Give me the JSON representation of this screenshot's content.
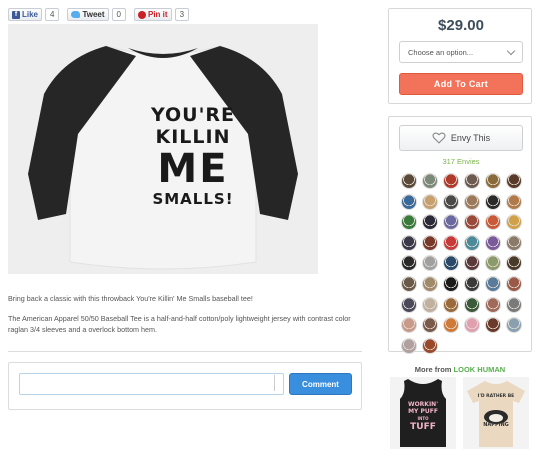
{
  "social": {
    "facebook": {
      "label": "Like",
      "count": "4"
    },
    "twitter": {
      "label": "Tweet",
      "count": "0"
    },
    "pinterest": {
      "label": "Pin it",
      "count": "3"
    }
  },
  "product": {
    "shirt_lines": [
      "YOU'RE",
      "KILLIN",
      "ME",
      "SMALLS!"
    ],
    "description_short": "Bring back a classic with this throwback You're Killin' Me Smalls baseball tee!",
    "description_long": "The American Apparel 50/50 Baseball Tee is a half-and-half cotton/poly lightweight jersey with contrast color raglan 3/4 sleeves and a overlock bottom hem.",
    "shirt_colors": {
      "body": "#f4f4f4",
      "sleeves": "#262626"
    }
  },
  "buy": {
    "price": "$29.00",
    "select_placeholder": "Choose an option...",
    "add_to_cart": "Add To Cart"
  },
  "envy": {
    "button_label": "Envy This",
    "count_label": "317 Envies",
    "avatar_colors": [
      "#5a4a3a",
      "#7b8a7a",
      "#b03a2a",
      "#6d5a50",
      "#8a6a3a",
      "#5a3a2a",
      "#3a6a9a",
      "#c8a070",
      "#4a4a4a",
      "#9a7a5a",
      "#2a2a2a",
      "#b07a4a",
      "#3a7a3a",
      "#2a2a3a",
      "#6a6aa0",
      "#9a4a3a",
      "#c85a3a",
      "#d0a04a",
      "#3a3a4a",
      "#7a3a2a",
      "#c83a3a",
      "#4a8a9a",
      "#7a5a9a",
      "#8a7a6a",
      "#2a2a2a",
      "#a0a0a0",
      "#2a4a6a",
      "#5a3a3a",
      "#8a9a6a",
      "#4a3a2a",
      "#6a5a4a",
      "#a08a6a",
      "#1a1a1a",
      "#3a3a3a",
      "#5a7a9a",
      "#9a5a4a",
      "#4a4a5a",
      "#c0b0a0",
      "#9a6a3a",
      "#3a5a3a",
      "#a06a5a",
      "#7a7a7a",
      "#c89a8a",
      "#7a5a4a",
      "#d07a3a",
      "#e0a0b0",
      "#6a3a2a",
      "#8aa0b0",
      "#b0a0a0",
      "#9a4a2a"
    ]
  },
  "more": {
    "prefix": "More from",
    "brand": "LOOK HUMAN",
    "thumb1_lines": [
      "WORKIN'",
      "MY PUFF",
      "INTO",
      "TUFF"
    ],
    "thumb2_lines": [
      "I'D RATHER BE",
      "NAPPING"
    ]
  },
  "comment": {
    "input_value": "",
    "button_label": "Comment"
  }
}
